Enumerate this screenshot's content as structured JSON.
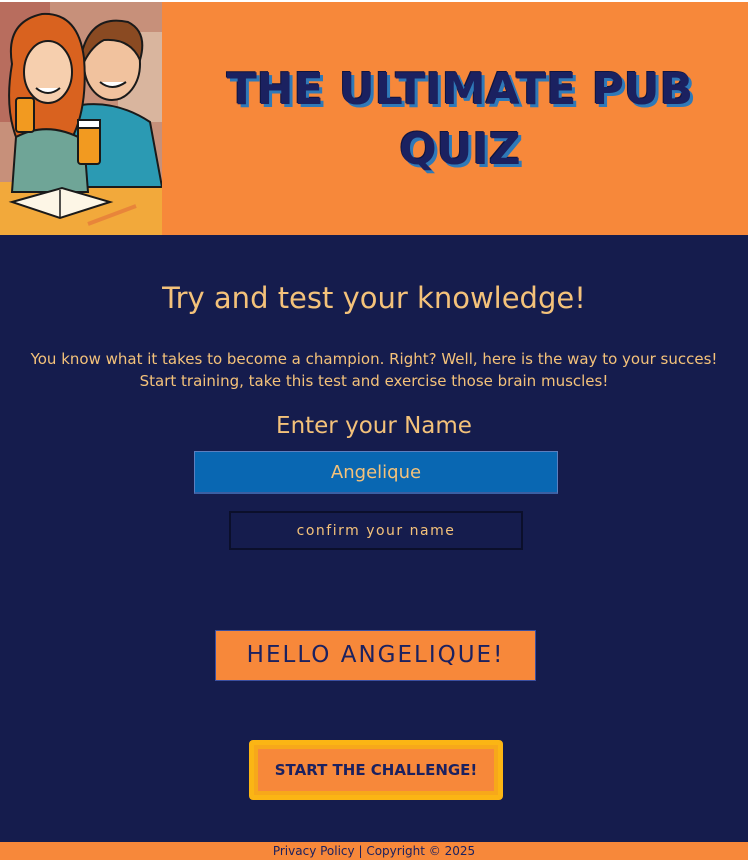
{
  "header": {
    "title": "THE ULTIMATE PUB QUIZ",
    "hero_image": "couple-with-beer-illustration"
  },
  "main": {
    "tagline": "Try and test your knowledge!",
    "intro_line_1": "You know what it takes to become a champion. Right? Well, here is the way to your succes!",
    "intro_line_2": "Start training, take this test and exercise those brain muscles!",
    "name_label": "Enter your Name",
    "name_value": "Angelique",
    "confirm_label": "confirm your name",
    "greeting": "HELLO ANGELIQUE!",
    "start_label": "START THE CHALLENGE!"
  },
  "footer": {
    "privacy_label": "Privacy Policy",
    "separator": "|",
    "copyright": "Copyright © 2025"
  },
  "colors": {
    "accent_orange": "#f7883a",
    "background_navy": "#151c4d",
    "text_gold": "#f4c27a",
    "input_blue": "#0967b2",
    "start_border": "#fbb514"
  }
}
